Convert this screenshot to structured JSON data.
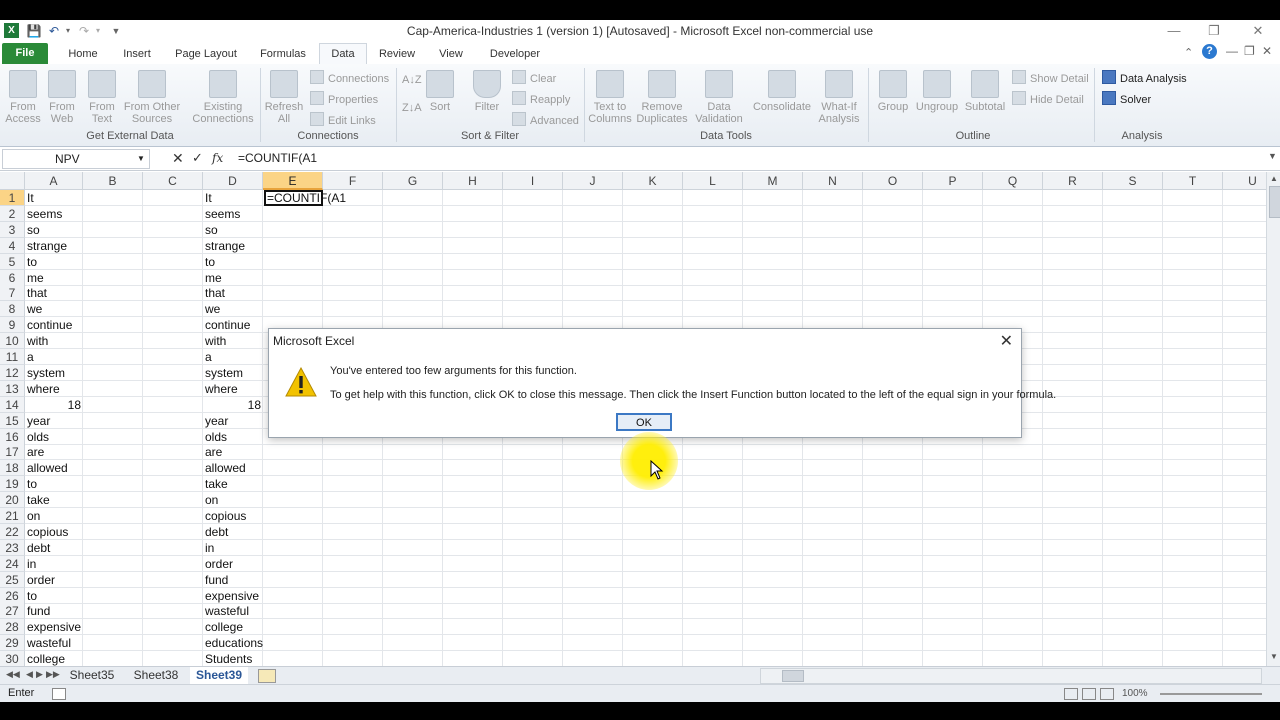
{
  "window": {
    "title": "Cap-America-Industries 1 (version 1) [Autosaved]  -  Microsoft Excel non-commercial use"
  },
  "ribbon": {
    "tabs": [
      "File",
      "Home",
      "Insert",
      "Page Layout",
      "Formulas",
      "Data",
      "Review",
      "View",
      "Developer"
    ],
    "active_tab": "Data",
    "groups": {
      "get_external": {
        "label": "Get External Data",
        "buttons": [
          [
            "From",
            "Access"
          ],
          [
            "From",
            "Web"
          ],
          [
            "From",
            "Text"
          ],
          [
            "From Other",
            "Sources"
          ],
          [
            "Existing",
            "Connections"
          ]
        ]
      },
      "connections": {
        "label": "Connections",
        "refresh": [
          "Refresh",
          "All"
        ],
        "items": [
          "Connections",
          "Properties",
          "Edit Links"
        ]
      },
      "sort_filter": {
        "label": "Sort & Filter",
        "sort": "Sort",
        "filter": "Filter",
        "items": [
          "Clear",
          "Reapply",
          "Advanced"
        ]
      },
      "data_tools": {
        "label": "Data Tools",
        "buttons": [
          [
            "Text to",
            "Columns"
          ],
          [
            "Remove",
            "Duplicates"
          ],
          [
            "Data",
            "Validation"
          ],
          [
            "Consolidate",
            ""
          ],
          [
            "What-If",
            "Analysis"
          ]
        ]
      },
      "outline": {
        "label": "Outline",
        "buttons": [
          "Group",
          "Ungroup",
          "Subtotal"
        ],
        "items": [
          "Show Detail",
          "Hide Detail"
        ]
      },
      "analysis": {
        "label": "Analysis",
        "items": [
          "Data Analysis",
          "Solver"
        ]
      }
    }
  },
  "formula_bar": {
    "name_box": "NPV",
    "fx": "fx",
    "formula": "=COUNTIF(A1"
  },
  "grid": {
    "columns": [
      "A",
      "B",
      "C",
      "D",
      "E",
      "F",
      "G",
      "H",
      "I",
      "J",
      "K",
      "L",
      "M",
      "N",
      "O",
      "P",
      "Q",
      "R",
      "S",
      "T",
      "U"
    ],
    "rows": [
      {
        "n": "1",
        "a": "It",
        "d": "It"
      },
      {
        "n": "2",
        "a": "seems",
        "d": "seems"
      },
      {
        "n": "3",
        "a": "so",
        "d": "so"
      },
      {
        "n": "4",
        "a": "strange",
        "d": "strange"
      },
      {
        "n": "5",
        "a": "to",
        "d": "to"
      },
      {
        "n": "6",
        "a": "me",
        "d": "me"
      },
      {
        "n": "7",
        "a": "that",
        "d": "that"
      },
      {
        "n": "8",
        "a": "we",
        "d": "we"
      },
      {
        "n": "9",
        "a": "continue",
        "d": "continue"
      },
      {
        "n": "10",
        "a": "with",
        "d": "with"
      },
      {
        "n": "11",
        "a": "a",
        "d": "a"
      },
      {
        "n": "12",
        "a": "system",
        "d": "system"
      },
      {
        "n": "13",
        "a": "where",
        "d": "where"
      },
      {
        "n": "14",
        "a": "18",
        "d": "18"
      },
      {
        "n": "15",
        "a": "year",
        "d": "year"
      },
      {
        "n": "16",
        "a": "olds",
        "d": "olds"
      },
      {
        "n": "17",
        "a": "are",
        "d": "are"
      },
      {
        "n": "18",
        "a": "allowed",
        "d": "allowed"
      },
      {
        "n": "19",
        "a": "to",
        "d": "take"
      },
      {
        "n": "20",
        "a": "take",
        "d": "on"
      },
      {
        "n": "21",
        "a": "on",
        "d": "copious"
      },
      {
        "n": "22",
        "a": "copious",
        "d": "debt"
      },
      {
        "n": "23",
        "a": "debt",
        "d": "in"
      },
      {
        "n": "24",
        "a": "in",
        "d": "order"
      },
      {
        "n": "25",
        "a": "order",
        "d": "fund"
      },
      {
        "n": "26",
        "a": "to",
        "d": "expensive"
      },
      {
        "n": "27",
        "a": "fund",
        "d": "wasteful"
      },
      {
        "n": "28",
        "a": "expensive",
        "d": "college"
      },
      {
        "n": "29",
        "a": "wasteful",
        "d": "educations"
      },
      {
        "n": "30",
        "a": "college",
        "d": "Students"
      }
    ],
    "active_cell_text": "=COUNTIF(A1"
  },
  "sheets": {
    "tabs": [
      "Sheet35",
      "Sheet38",
      "Sheet39"
    ],
    "active": "Sheet39"
  },
  "status": {
    "mode": "Enter",
    "zoom": "100%"
  },
  "dialog": {
    "title": "Microsoft Excel",
    "message1": "You've entered too few arguments for this function.",
    "message2": "To get help with this function, click OK to close this message. Then click the Insert Function button located to the left of the equal sign in your formula.",
    "ok": "OK"
  },
  "colors": {
    "file_tab": "#2a8a38",
    "selected_header": "#fbd486",
    "ok_border": "#3b78c4",
    "warning": "#f2c200"
  }
}
